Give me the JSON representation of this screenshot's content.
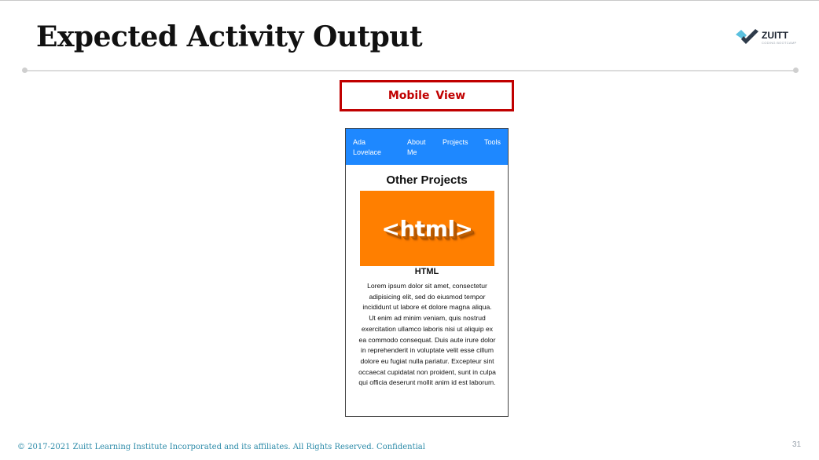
{
  "slide": {
    "title": "Expected Activity Output",
    "view_label": "Mobile View",
    "footer": "© 2017-2021 Zuitt Learning Institute Incorporated and its affiliates. All Rights Reserved. Confidential",
    "page_number": "31"
  },
  "logo": {
    "word": "ZUITT",
    "tagline": "CODING BOOTCAMP"
  },
  "mobile": {
    "nav": {
      "brand": "Ada Lovelace",
      "items": [
        "About Me",
        "Projects",
        "Tools"
      ]
    },
    "section_heading": "Other Projects",
    "project": {
      "image_text": "<html>",
      "title": "HTML",
      "description": "Lorem ipsum dolor sit amet, consectetur adipisicing elit, sed do eiusmod tempor incididunt ut labore et dolore magna aliqua. Ut enim ad minim veniam, quis nostrud exercitation ullamco laboris nisi ut aliquip ex ea commodo consequat. Duis aute irure dolor in reprehenderit in voluptate velit esse cillum dolore eu fugiat nulla pariatur. Excepteur sint occaecat cupidatat non proident, sunt in culpa qui officia deserunt mollit anim id est laborum."
    }
  },
  "colors": {
    "nav_blue": "#1e88ff",
    "html_orange": "#ff7f00",
    "label_red": "#c00000",
    "footer_teal": "#2b8aa8"
  }
}
